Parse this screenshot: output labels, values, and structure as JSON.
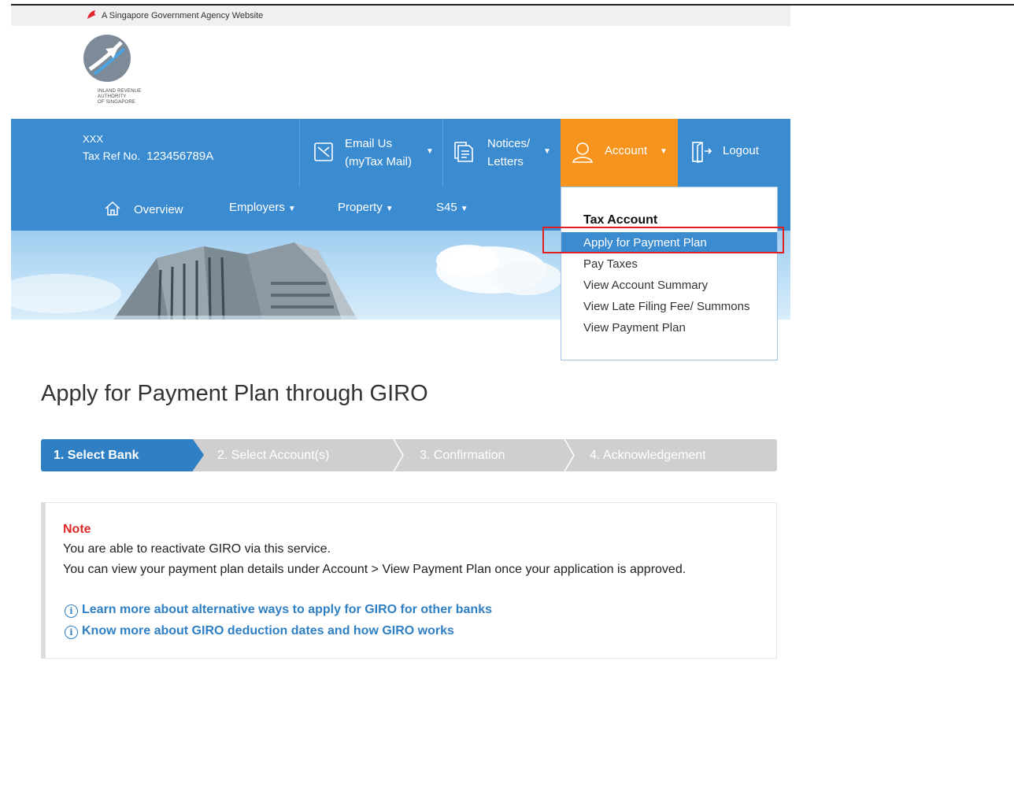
{
  "gov_banner": {
    "text": "A Singapore Government Agency Website"
  },
  "logo": {
    "line1": "INLAND REVENUE",
    "line2": "AUTHORITY",
    "line3": "OF SINGAPORE"
  },
  "user": {
    "name": "XXX",
    "tax_ref_label": "Tax Ref No.",
    "tax_ref_value": "123456789A"
  },
  "top_nav": {
    "email": {
      "line1": "Email Us",
      "line2": "(myTax Mail)"
    },
    "notices": {
      "line1": "Notices/",
      "line2": "Letters"
    },
    "account": "Account",
    "logout": "Logout"
  },
  "sub_nav": {
    "overview": "Overview",
    "employers": "Employers",
    "property": "Property",
    "s45": "S45"
  },
  "account_dropdown": {
    "heading": "Tax Account",
    "items": [
      "Apply for Payment Plan",
      "Pay Taxes",
      "View Account Summary",
      "View Late Filing Fee/ Summons",
      "View Payment Plan"
    ],
    "selected": "Apply for Payment Plan"
  },
  "page_title": "Apply for Payment Plan through GIRO",
  "steps": [
    "1. Select Bank",
    "2. Select Account(s)",
    "3. Confirmation",
    "4. Acknowledgement"
  ],
  "current_step": 1,
  "note": {
    "title": "Note",
    "line1": "You are able to reactivate GIRO via this service.",
    "line2": "You can view your payment plan details under Account > View Payment Plan once your application is approved.",
    "link1": "Learn more about alternative ways to apply for GIRO for other banks",
    "link2": "Know more about GIRO deduction dates and how GIRO works"
  },
  "colors": {
    "brand_blue": "#3b8bd0",
    "account_orange": "#f7941d",
    "note_red": "#e02828",
    "link_blue": "#2f7fc4",
    "highlight_red": "#e02020"
  }
}
